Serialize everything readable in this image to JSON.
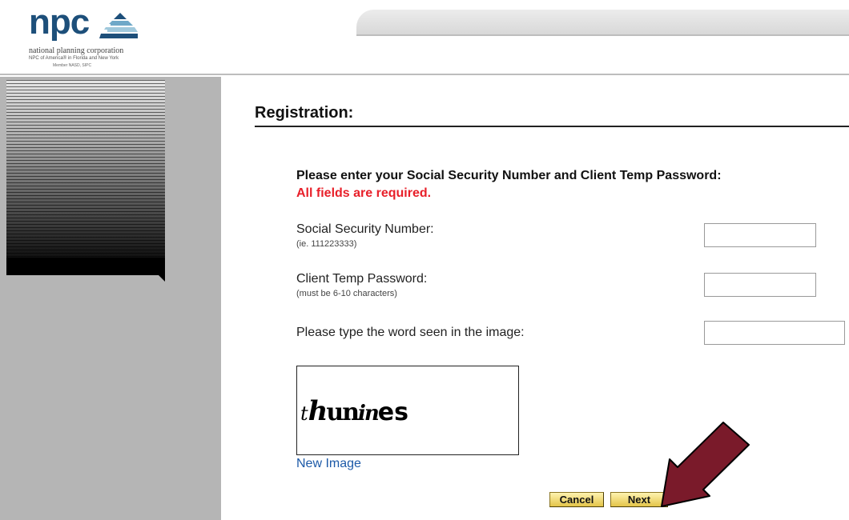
{
  "header": {
    "logo_text": "npc",
    "logo_tagline": "national planning corporation",
    "logo_line2": "NPC of America® in Florida and New York",
    "logo_line3": "Member NASD, SIPC"
  },
  "page": {
    "title": "Registration:"
  },
  "form": {
    "instruction": "Please enter your Social Security Number and Client Temp Password:",
    "required_note": "All fields are required.",
    "ssn": {
      "label": "Social Security Number:",
      "hint": "(ie. 111223333)",
      "value": ""
    },
    "temp_password": {
      "label": "Client Temp Password:",
      "hint": "(must be 6-10 characters)",
      "value": ""
    },
    "captcha": {
      "label": "Please type the word seen in the image:",
      "value": "",
      "image_word": "thunines"
    },
    "new_image_link": "New Image",
    "cancel_label": "Cancel",
    "next_label": "Next"
  },
  "colors": {
    "brand_blue": "#1d4f7a",
    "required_red": "#e8202a",
    "link_blue": "#1d5aa8",
    "button_gold": "#e3c449",
    "annotation_arrow": "#7a1a2a"
  },
  "icons": {
    "logo_mark": "pyramid-logo-icon",
    "annotation": "pointer-arrow"
  }
}
